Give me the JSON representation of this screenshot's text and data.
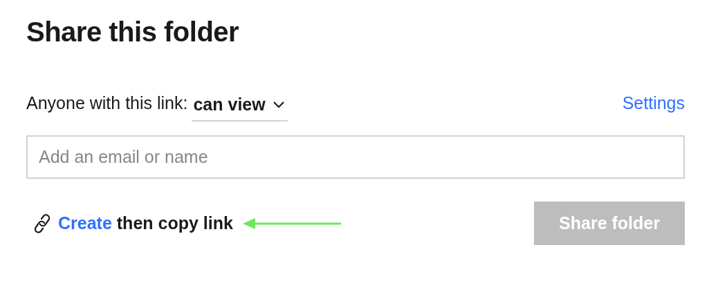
{
  "title": "Share this folder",
  "access": {
    "label": "Anyone with this link:",
    "permission": "can view"
  },
  "settings_link": "Settings",
  "email_field": {
    "placeholder": "Add an email or name"
  },
  "create_link": {
    "action": "Create",
    "rest": "then copy link"
  },
  "share_button": {
    "label": "Share folder",
    "disabled": true
  }
}
